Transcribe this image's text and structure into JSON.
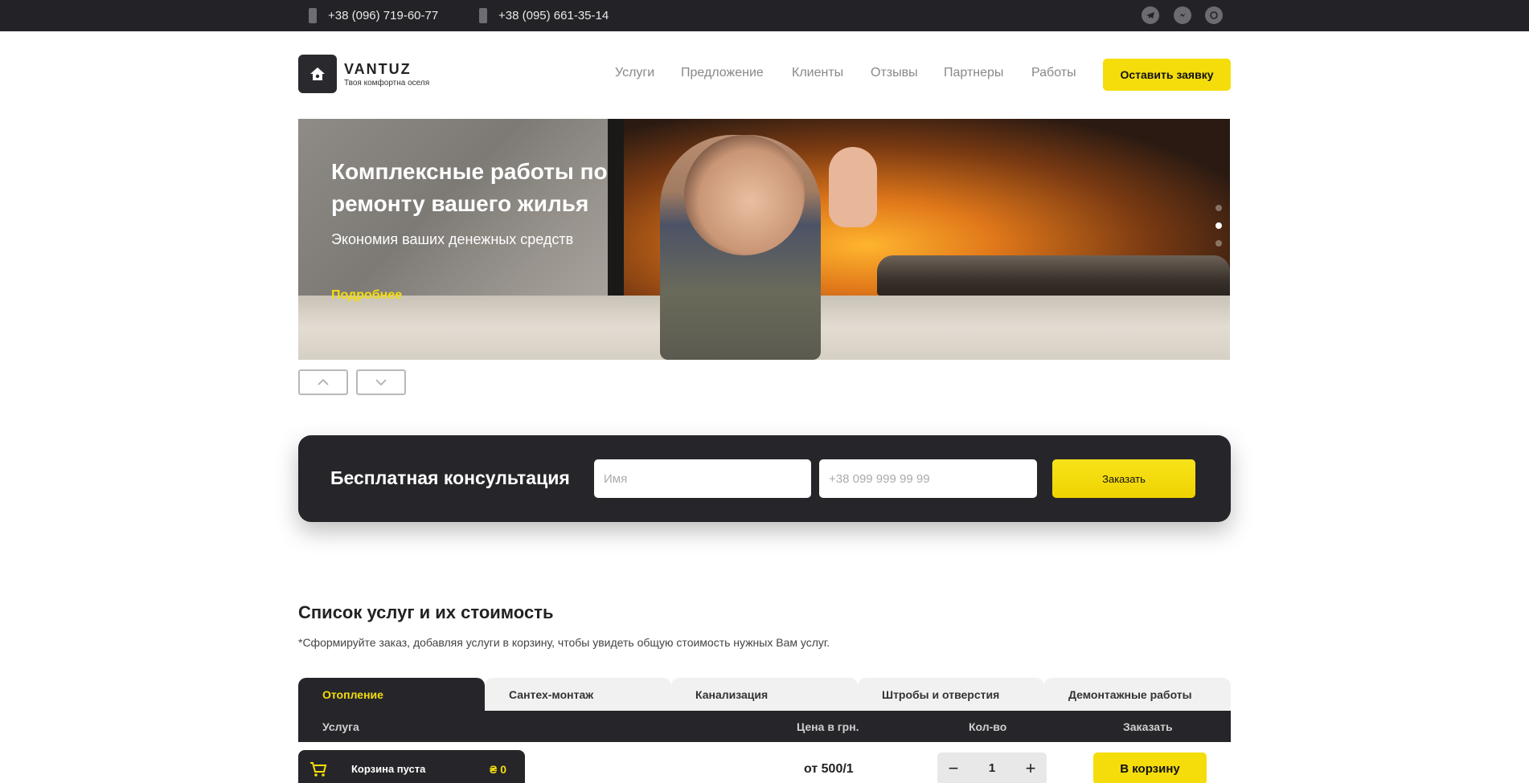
{
  "topbar": {
    "phones": [
      "+38 (096) 719-60-77",
      "+38 (095) 661-35-14"
    ],
    "socials": [
      "telegram-icon",
      "messenger-icon",
      "whatsapp-icon"
    ]
  },
  "header": {
    "logo_name": "VANTUZ",
    "logo_tagline": "Твоя комфортна оселя",
    "nav": [
      "Услуги",
      "Предложение",
      "Клиенты",
      "Отзывы",
      "Партнеры",
      "Работы"
    ],
    "cta": "Оставить заявку"
  },
  "hero": {
    "title": "Комплексные работы по ремонту вашего жилья",
    "subtitle": "Экономия ваших денежных средств",
    "more": "Подробнее",
    "slides_count": 3,
    "active_slide": 2
  },
  "consult": {
    "title": "Бесплатная консультация",
    "name_placeholder": "Имя",
    "phone_placeholder": "+38 099 999 99 99",
    "button": "Заказать"
  },
  "services": {
    "title": "Список услуг и их стоимость",
    "note": "*Сформируйте заказ, добавляя услуги в корзину, чтобы увидеть общую стоимость нужных Вам услуг.",
    "tabs": [
      "Отопление",
      "Сантех-монтаж",
      "Канализация",
      "Штробы и отверстия",
      "Демонтажные работы"
    ],
    "active_tab": 0,
    "columns": {
      "service": "Услуга",
      "price": "Цена в грн.",
      "qty": "Кол-во",
      "order": "Заказать"
    },
    "row": {
      "price": "от 500/1",
      "qty": "1",
      "button": "В корзину"
    }
  },
  "cart": {
    "label": "Корзина пуста",
    "sum": "₴ 0"
  },
  "colors": {
    "accent": "#f5dd0c",
    "dark": "#26262a"
  }
}
